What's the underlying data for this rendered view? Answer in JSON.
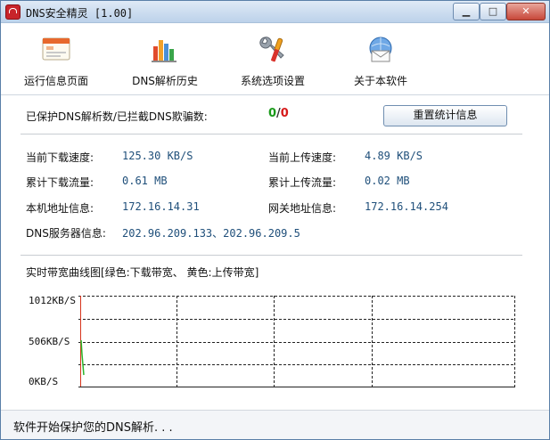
{
  "window": {
    "title": "DNS安全精灵 [1.00]"
  },
  "toolbar": {
    "items": [
      {
        "label": "运行信息页面",
        "icon": "window-info-icon"
      },
      {
        "label": "DNS解析历史",
        "icon": "bar-chart-icon"
      },
      {
        "label": "系统选项设置",
        "icon": "tools-icon"
      },
      {
        "label": "关于本软件",
        "icon": "globe-envelope-icon"
      }
    ]
  },
  "stats": {
    "protected_label": "已保护DNS解析数/已拦截DNS欺骗数:",
    "protected_count": "0",
    "separator": "/",
    "blocked_count": "0",
    "reset_label": "重置统计信息",
    "colors": {
      "protected": "#1a9a1a",
      "blocked": "#d61a1a"
    }
  },
  "info": {
    "download_speed_label": "当前下载速度:",
    "download_speed": "125.30 KB/S",
    "upload_speed_label": "当前上传速度:",
    "upload_speed": "4.89 KB/S",
    "download_total_label": "累计下载流量:",
    "download_total": "0.61 MB",
    "upload_total_label": "累计上传流量:",
    "upload_total": "0.02 MB",
    "local_addr_label": "本机地址信息:",
    "local_addr": "172.16.14.31",
    "gateway_label": "网关地址信息:",
    "gateway": "172.16.14.254",
    "dns_label": "DNS服务器信息:",
    "dns_servers": "202.96.209.133、202.96.209.5"
  },
  "bandwidth": {
    "title": "实时带宽曲线图[绿色:下载带宽、 黄色:上传带宽]",
    "ylabels": [
      "1012KB/S",
      "506KB/S",
      "0KB/S"
    ],
    "colors": {
      "download": "#2bb52b",
      "upload": "#e8c020"
    }
  },
  "status": {
    "text": "软件开始保护您的DNS解析. . ."
  }
}
